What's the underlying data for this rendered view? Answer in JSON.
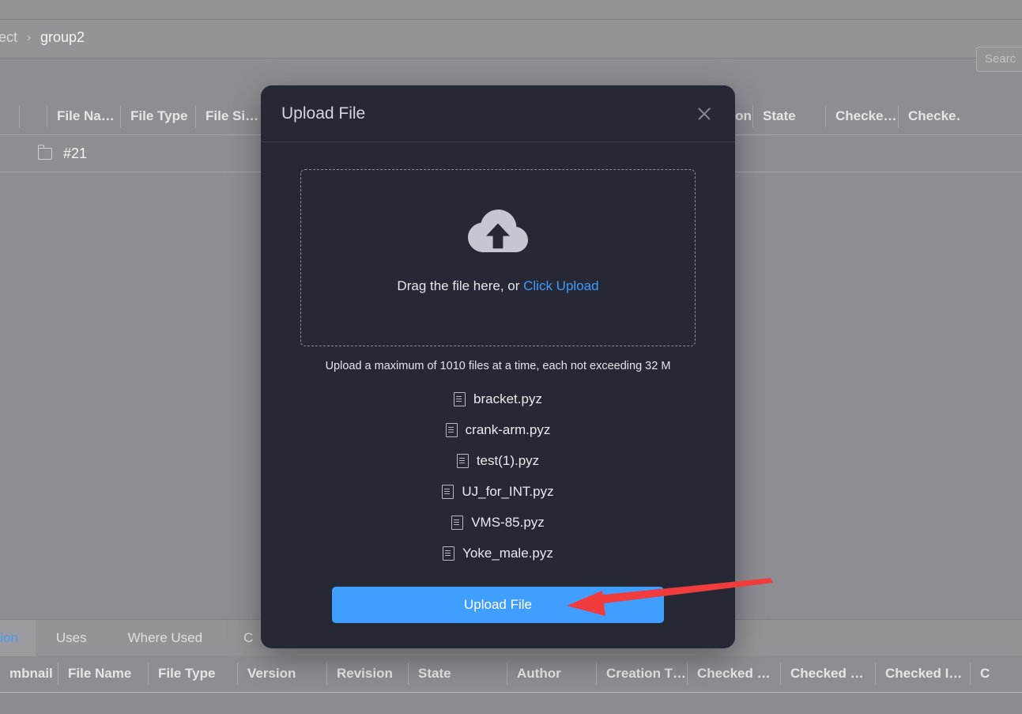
{
  "breadcrumb": {
    "items": [
      "roject",
      "group2"
    ],
    "separator": "›"
  },
  "search": {
    "placeholder": "Searc"
  },
  "main_table": {
    "headers": [
      "",
      "",
      "File Na…",
      "File Type",
      "File Si…",
      "Revision",
      "State",
      "Checke…",
      "Checke…"
    ],
    "rows": [
      {
        "name": "#21",
        "icon": "folder-icon"
      }
    ]
  },
  "bottom_panel": {
    "tabs": [
      "rsion",
      "Uses",
      "Where Used",
      "C"
    ],
    "active_tab": "rsion",
    "headers": [
      "mbnail",
      "File Name",
      "File Type",
      "Version",
      "Revision",
      "State",
      "Author",
      "Creation T…",
      "Checked …",
      "Checked …",
      "Checked I…",
      "C"
    ]
  },
  "modal": {
    "title": "Upload File",
    "close_icon": "close-icon",
    "dropzone": {
      "icon": "cloud-upload-icon",
      "text_prefix": "Drag the file here, or ",
      "link_text": "Click Upload"
    },
    "hint": "Upload a maximum of 1010 files at a time, each not exceeding 32 M",
    "files": [
      {
        "name": "bracket.pyz"
      },
      {
        "name": "crank-arm.pyz"
      },
      {
        "name": "test(1).pyz"
      },
      {
        "name": "UJ_for_INT.pyz"
      },
      {
        "name": "VMS-85.pyz"
      },
      {
        "name": "Yoke_male.pyz"
      }
    ],
    "submit_label": "Upload File"
  },
  "annotation": {
    "arrow_color": "#f03c3c",
    "points_to": "Upload File"
  },
  "colors": {
    "accent_blue": "#409eff",
    "link_blue": "#3d9bfb",
    "modal_bg": "#262935",
    "page_bg": "#939399",
    "arrow_red": "#f03c3c"
  }
}
